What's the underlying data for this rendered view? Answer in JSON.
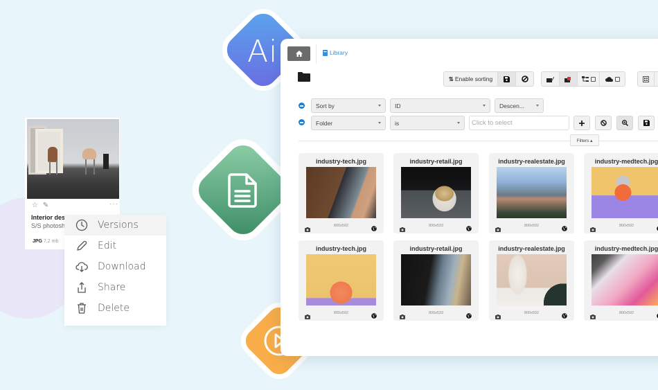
{
  "decor": {
    "ai_label": "Ai",
    "doc_icon": "document-icon",
    "video_icon": "play-icon",
    "colors": {
      "ai": "#6a8ee8",
      "doc": "#5aa981",
      "video": "#f8ad49",
      "background": "#e8f5fb"
    }
  },
  "asset_card": {
    "title": "Interior des",
    "subtitle": "S/S photosh",
    "format": "JPG",
    "size": "7,2 mb",
    "more": "···"
  },
  "context_menu": {
    "items": [
      {
        "label": "Versions",
        "icon": "clock-icon",
        "active": true
      },
      {
        "label": "Edit",
        "icon": "pencil-icon"
      },
      {
        "label": "Download",
        "icon": "cloud-download-icon"
      },
      {
        "label": "Share",
        "icon": "share-icon"
      },
      {
        "label": "Delete",
        "icon": "trash-icon"
      }
    ]
  },
  "app": {
    "breadcrumb": {
      "home_icon": "home-icon",
      "library_label": "Library"
    },
    "toolbar": {
      "enable_sorting_label": "Enable sorting"
    },
    "filters": {
      "row1": {
        "field": "Sort by",
        "value": "ID",
        "order": "Descen..."
      },
      "row2": {
        "field": "Folder",
        "operator": "is",
        "placeholder": "Click to select"
      },
      "filters_toggle": "Filters ▴"
    },
    "accent": "#1a7fd4",
    "grid": [
      {
        "name": "industry-tech.jpg",
        "dims": "800x592"
      },
      {
        "name": "industry-retail.jpg",
        "dims": "800x533"
      },
      {
        "name": "industry-realestate.jpg",
        "dims": "800x592"
      },
      {
        "name": "industry-medtech.jpg",
        "dims": "800x592"
      },
      {
        "name": "industry-tech.jpg",
        "dims": "800x592"
      },
      {
        "name": "industry-retail.jpg",
        "dims": "800x533"
      },
      {
        "name": "industry-realestate.jpg",
        "dims": "800x592"
      },
      {
        "name": "industry-medtech.jpg",
        "dims": "800x592"
      }
    ]
  }
}
